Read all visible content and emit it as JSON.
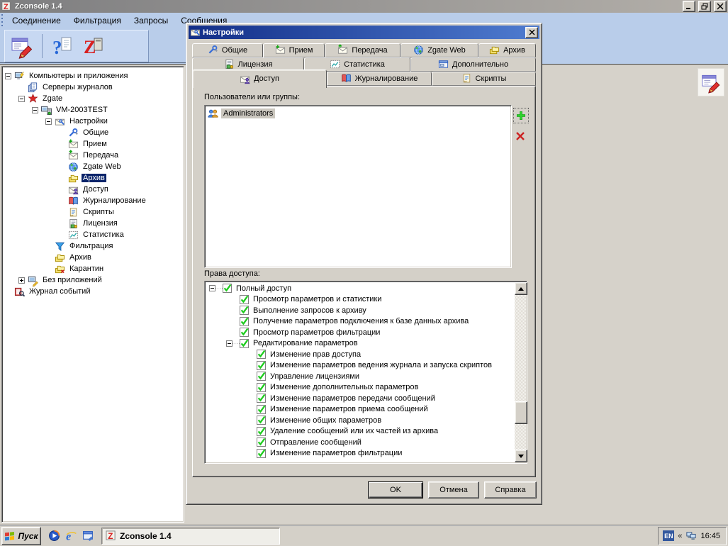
{
  "window": {
    "title": "Zconsole 1.4",
    "menu": [
      "Соединение",
      "Фильтрация",
      "Запросы",
      "Сообщения"
    ],
    "toolbar_icons": [
      "notes-edit",
      "help",
      "zconsole"
    ]
  },
  "tree": {
    "items": [
      {
        "label": "Компьютеры и приложения",
        "icon": "computer-flash",
        "level": 0,
        "expander": "minus"
      },
      {
        "label": "Серверы журналов",
        "icon": "pages",
        "level": 1
      },
      {
        "label": "Zgate",
        "icon": "zgate",
        "level": 1,
        "expander": "minus"
      },
      {
        "label": "VM-2003TEST",
        "icon": "computer",
        "level": 2,
        "expander": "minus"
      },
      {
        "label": "Настройки",
        "icon": "settings",
        "level": 3,
        "expander": "minus"
      },
      {
        "label": "Общие",
        "icon": "wrench",
        "level": 4
      },
      {
        "label": "Прием",
        "icon": "mail-in",
        "level": 4
      },
      {
        "label": "Передача",
        "icon": "mail-out",
        "level": 4
      },
      {
        "label": "Zgate Web",
        "icon": "globe",
        "level": 4
      },
      {
        "label": "Архив",
        "icon": "folders",
        "level": 4,
        "selected": true
      },
      {
        "label": "Доступ",
        "icon": "mail-user",
        "level": 4
      },
      {
        "label": "Журналирование",
        "icon": "book",
        "level": 4
      },
      {
        "label": "Скрипты",
        "icon": "scroll",
        "level": 4
      },
      {
        "label": "Лицензия",
        "icon": "license",
        "level": 4
      },
      {
        "label": "Статистика",
        "icon": "chart",
        "level": 4
      },
      {
        "label": "Фильтрация",
        "icon": "funnel",
        "level": 3
      },
      {
        "label": "Архив",
        "icon": "folders",
        "level": 3
      },
      {
        "label": "Карантин",
        "icon": "folders-x",
        "level": 3
      },
      {
        "label": "Без приложений",
        "icon": "computer-edit",
        "level": 1,
        "expander": "plus"
      },
      {
        "label": "Журнал событий",
        "icon": "book-search",
        "level": 0
      }
    ]
  },
  "dialog": {
    "title": "Настройки",
    "tab_rows": [
      [
        {
          "label": "Общие",
          "icon": "wrench"
        },
        {
          "label": "Прием",
          "icon": "mail-in"
        },
        {
          "label": "Передача",
          "icon": "mail-out"
        },
        {
          "label": "Zgate Web",
          "icon": "globe"
        },
        {
          "label": "Архив",
          "icon": "folders"
        }
      ],
      [
        {
          "label": "Лицензия",
          "icon": "license"
        },
        {
          "label": "Статистика",
          "icon": "chart"
        },
        {
          "label": "Дополнительно",
          "icon": "window"
        }
      ],
      [
        {
          "label": "Доступ",
          "icon": "mail-user",
          "active": true
        },
        {
          "label": "Журналирование",
          "icon": "book"
        },
        {
          "label": "Скрипты",
          "icon": "scroll"
        }
      ]
    ],
    "users_label": "Пользователи или группы:",
    "users": [
      {
        "name": "Administrators",
        "icon": "users",
        "selected": true
      }
    ],
    "rights_label": "Права доступа:",
    "rights": [
      {
        "label": "Полный доступ",
        "level": 0,
        "expander": "minus",
        "checked": true
      },
      {
        "label": "Просмотр параметров и статистики",
        "level": 1,
        "checked": true
      },
      {
        "label": "Выполнение запросов к архиву",
        "level": 1,
        "checked": true
      },
      {
        "label": "Получение параметров подключения к базе данных архива",
        "level": 1,
        "checked": true
      },
      {
        "label": "Просмотр параметров фильтрации",
        "level": 1,
        "checked": true
      },
      {
        "label": "Редактирование параметров",
        "level": 1,
        "expander": "minus",
        "checked": true
      },
      {
        "label": "Изменение прав доступа",
        "level": 2,
        "checked": true
      },
      {
        "label": "Изменение параметров ведения журнала и запуска скриптов",
        "level": 2,
        "checked": true
      },
      {
        "label": "Управление лицензиями",
        "level": 2,
        "checked": true
      },
      {
        "label": "Изменение дополнительных параметров",
        "level": 2,
        "checked": true
      },
      {
        "label": "Изменение параметров передачи сообщений",
        "level": 2,
        "checked": true
      },
      {
        "label": "Изменение параметров приема сообщений",
        "level": 2,
        "checked": true
      },
      {
        "label": "Изменение общих параметров",
        "level": 2,
        "checked": true
      },
      {
        "label": "Удаление сообщений или их частей из архива",
        "level": 2,
        "checked": true
      },
      {
        "label": "Отправление сообщений",
        "level": 2,
        "checked": true
      },
      {
        "label": "Изменение параметров фильтрации",
        "level": 2,
        "checked": true
      }
    ],
    "buttons": {
      "ok": "OK",
      "cancel": "Отмена",
      "help": "Справка"
    }
  },
  "taskbar": {
    "start_label": "Пуск",
    "task_label": "Zconsole 1.4",
    "tray": {
      "lang": "EN",
      "chevron": "«",
      "time": "16:45"
    }
  },
  "colors": {
    "menubar_blue": "#B9CDEA",
    "classic_gray": "#D4D0C8",
    "selection_navy": "#0A246A",
    "check_green": "#1ECC1E",
    "dialog_title_start": "#122E88",
    "dialog_title_end": "#4F7CD0"
  }
}
